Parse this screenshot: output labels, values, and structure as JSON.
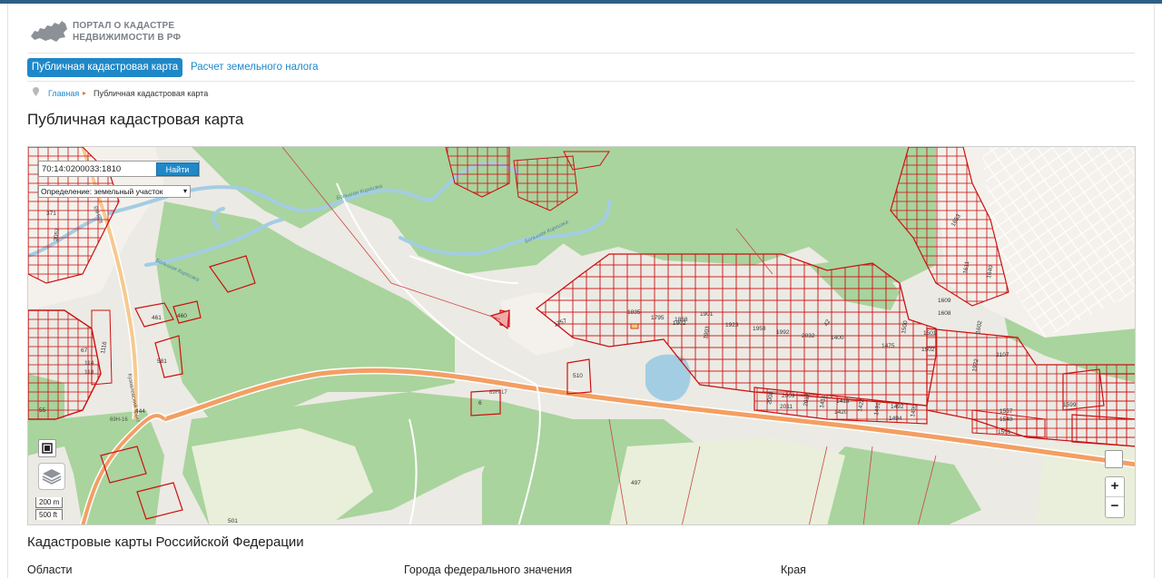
{
  "site": {
    "logo_line1": "ПОРТАЛ О КАДАСТРЕ",
    "logo_line2": "НЕДВИЖИМОСТИ В РФ",
    "logo_icon": "russia-map-icon",
    "accent_color": "#1e88c9"
  },
  "nav": {
    "active": "Публичная кадастровая карта",
    "link": "Расчет земельного налога"
  },
  "breadcrumb": {
    "home": "Главная",
    "current": "Публичная кадастровая карта"
  },
  "page_title": "Публичная кадастровая карта",
  "map": {
    "search_value": "70:14:0200033:1810",
    "search_button": "Найти",
    "definition_label": "Определение:",
    "definition_value": "земельный участок",
    "scale_m": "200 m",
    "scale_ft": "500 ft",
    "zoom_in": "+",
    "zoom_out": "−",
    "river_labels": [
      "Большая Киргизка",
      "Большая Киргизка",
      "Большая Киргизка"
    ],
    "road_labels": [
      "69Н-17",
      "69Н-16",
      "Кузовлевский тракт",
      "69Н-28"
    ],
    "plot_labels": [
      "371",
      "3057",
      "461",
      "460",
      "581",
      "1835",
      "1795",
      "1868",
      "1902",
      "1901",
      "1923",
      "1958",
      "1992",
      "2032",
      "1400",
      "1501",
      "1502",
      "1475",
      "1500",
      "2107",
      "1653",
      "1609",
      "1608",
      "1640",
      "1602",
      "1922",
      "510",
      "6",
      "497",
      "501",
      "2008",
      "2009",
      "2011",
      "2012",
      "1416",
      "1418",
      "1420",
      "1422",
      "1491",
      "1492",
      "1494",
      "1495",
      "1557",
      "1549",
      "1551",
      "1599",
      "1903",
      "444",
      "55",
      "114",
      "118",
      "1116",
      "67",
      "1757",
      "1611",
      "42"
    ],
    "colors": {
      "forest": "#a9d49d",
      "open": "#f1efea",
      "field": "#e8efd8",
      "river": "#a3cde3",
      "road": "#f39f63",
      "cadastre": "#cc1111"
    }
  },
  "footer": {
    "section_title": "Кадастровые карты Российской Федерации",
    "columns": [
      "Области",
      "Города федерального значения",
      "Края"
    ]
  }
}
